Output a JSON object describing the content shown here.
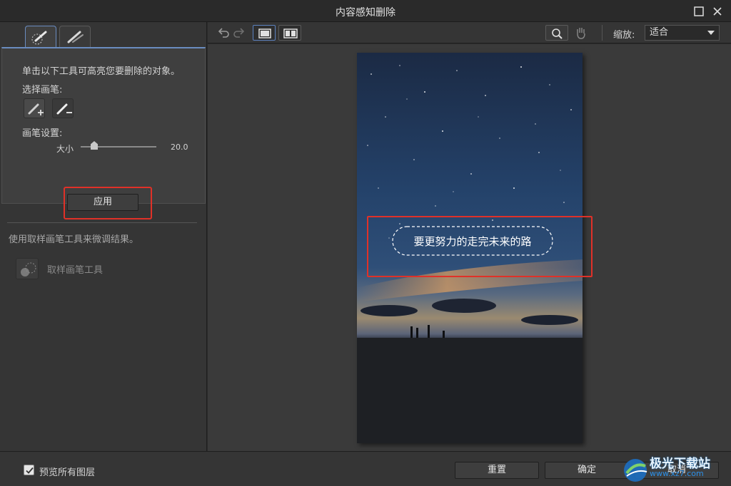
{
  "window": {
    "title": "内容感知删除"
  },
  "left_panel": {
    "instruction": "单击以下工具可高亮您要删除的对象。",
    "select_brush_label": "选择画笔:",
    "brush_settings_label": "画笔设置:",
    "size_label": "大小",
    "size_value": "20.0",
    "size_slider_fraction": 0.15,
    "apply_label": "应用",
    "refine_text": "使用取样画笔工具来微调结果。",
    "sample_tool_label": "取样画笔工具"
  },
  "toolbar": {
    "zoom_label": "缩放:",
    "zoom_value": "适合"
  },
  "canvas": {
    "photo_text": "要更努力的走完未来的路"
  },
  "bottom": {
    "preview_all_layers_label": "预览所有图层",
    "preview_all_layers_checked": true,
    "reset_label": "重置",
    "ok_label": "确定",
    "cancel_label": "取消"
  },
  "watermark": {
    "text": "极光下载站",
    "url": "www.xz7.com"
  },
  "colors": {
    "highlight": "#e03128",
    "accent": "#6a8cc0"
  }
}
